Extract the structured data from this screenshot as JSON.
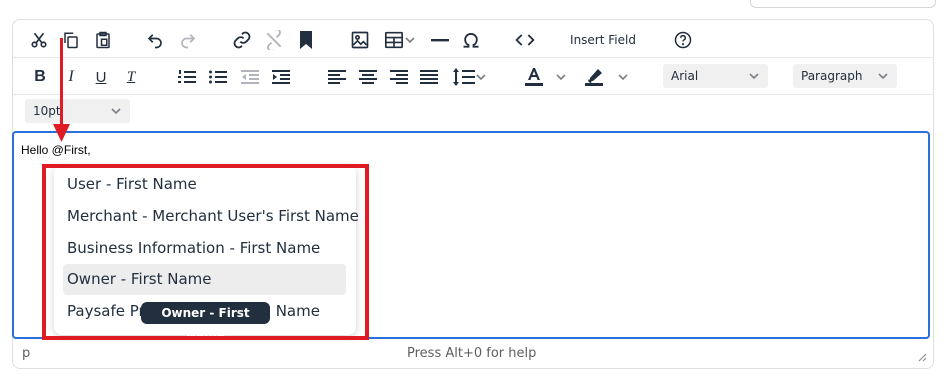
{
  "toolbar": {
    "row1": {
      "cut_icon": "scissors-icon",
      "copy_icon": "copy-icon",
      "paste_icon": "clipboard-icon",
      "undo_icon": "undo-icon",
      "redo_icon": "redo-icon",
      "link_icon": "link-icon",
      "unlink_icon": "unlink-icon",
      "bookmark_icon": "bookmark-icon",
      "image_icon": "image-icon",
      "table_icon": "table-icon",
      "hr_icon": "horizontal-rule-icon",
      "special_char_icon": "omega-icon",
      "code_icon": "code-icon",
      "insert_field_label": "Insert Field",
      "help_icon": "help-circle-icon"
    },
    "row2": {
      "bold_label": "B",
      "italic_label": "I",
      "underline_label": "U",
      "clear_format_label": "T",
      "font_family": "Arial",
      "block_format": "Paragraph"
    },
    "row3": {
      "font_size": "10pt"
    }
  },
  "content": {
    "text": "Hello @First,"
  },
  "autocomplete": {
    "items": [
      {
        "label": "User - First Name",
        "active": false
      },
      {
        "label": "Merchant - Merchant User's First Name",
        "active": false
      },
      {
        "label": "Business Information - First Name",
        "active": false
      },
      {
        "label": "Owner - First Name",
        "active": true
      },
      {
        "label": "Paysafe Pr",
        "suffix": "Name",
        "active": false
      }
    ],
    "tooltip": "Owner - First Name"
  },
  "statusbar": {
    "path": "p",
    "help": "Press Alt+0 for help"
  },
  "colors": {
    "focus_border": "#2a6fdb",
    "annotation_red": "#e01b24",
    "tooltip_bg": "#222f3e",
    "active_item_bg": "#ededed",
    "icon_color": "#222f3e"
  }
}
